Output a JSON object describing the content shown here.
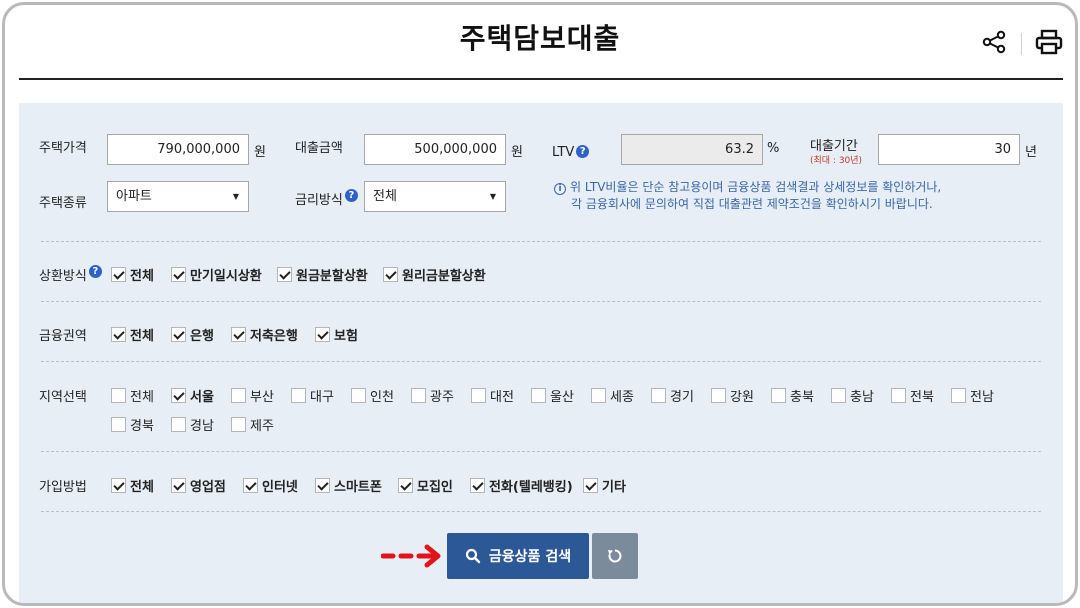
{
  "page": {
    "title": "주택담보대출"
  },
  "form": {
    "house_price": {
      "label": "주택가격",
      "value": "790,000,000",
      "unit": "원"
    },
    "loan_amount": {
      "label": "대출금액",
      "value": "500,000,000",
      "unit": "원"
    },
    "ltv": {
      "label": "LTV",
      "value": "63.2",
      "unit": "%"
    },
    "loan_period": {
      "label": "대출기간",
      "sublabel": "(최대 : 30년)",
      "value": "30",
      "unit": "년"
    },
    "house_type": {
      "label": "주택종류",
      "selected": "아파트"
    },
    "rate_type": {
      "label": "금리방식",
      "selected": "전체"
    },
    "ltv_note": {
      "line1": "위 LTV비율은 단순 참고용이며 금융상품 검색결과 상세정보를 확인하거나,",
      "line2": "각 금융회사에 문의하여 직접 대출관련 제약조건을 확인하시기 바랍니다."
    }
  },
  "repayment": {
    "label": "상환방식",
    "options": [
      {
        "label": "전체",
        "checked": true
      },
      {
        "label": "만기일시상환",
        "checked": true
      },
      {
        "label": "원금분할상환",
        "checked": true
      },
      {
        "label": "원리금분할상환",
        "checked": true
      }
    ]
  },
  "sector": {
    "label": "금융권역",
    "options": [
      {
        "label": "전체",
        "checked": true
      },
      {
        "label": "은행",
        "checked": true
      },
      {
        "label": "저축은행",
        "checked": true
      },
      {
        "label": "보험",
        "checked": true
      }
    ]
  },
  "region": {
    "label": "지역선택",
    "row1": [
      {
        "label": "전체",
        "checked": false
      },
      {
        "label": "서울",
        "checked": true
      },
      {
        "label": "부산",
        "checked": false
      },
      {
        "label": "대구",
        "checked": false
      },
      {
        "label": "인천",
        "checked": false
      },
      {
        "label": "광주",
        "checked": false
      },
      {
        "label": "대전",
        "checked": false
      },
      {
        "label": "울산",
        "checked": false
      },
      {
        "label": "세종",
        "checked": false
      },
      {
        "label": "경기",
        "checked": false
      },
      {
        "label": "강원",
        "checked": false
      },
      {
        "label": "충북",
        "checked": false
      },
      {
        "label": "충남",
        "checked": false
      },
      {
        "label": "전북",
        "checked": false
      },
      {
        "label": "전남",
        "checked": false
      }
    ],
    "row2": [
      {
        "label": "경북",
        "checked": false
      },
      {
        "label": "경남",
        "checked": false
      },
      {
        "label": "제주",
        "checked": false
      }
    ]
  },
  "channel": {
    "label": "가입방법",
    "options": [
      {
        "label": "전체",
        "checked": true
      },
      {
        "label": "영업점",
        "checked": true
      },
      {
        "label": "인터넷",
        "checked": true
      },
      {
        "label": "스마트폰",
        "checked": true
      },
      {
        "label": "모집인",
        "checked": true
      },
      {
        "label": "전화(텔레뱅킹)",
        "checked": true
      },
      {
        "label": "기타",
        "checked": true
      }
    ]
  },
  "actions": {
    "search_label": "금융상품 검색"
  },
  "colors": {
    "accent": "#2d5897",
    "reset": "#7c8b9c",
    "panel": "#e8eef5",
    "arrow": "#e0151b",
    "help": "#2f62c7"
  }
}
